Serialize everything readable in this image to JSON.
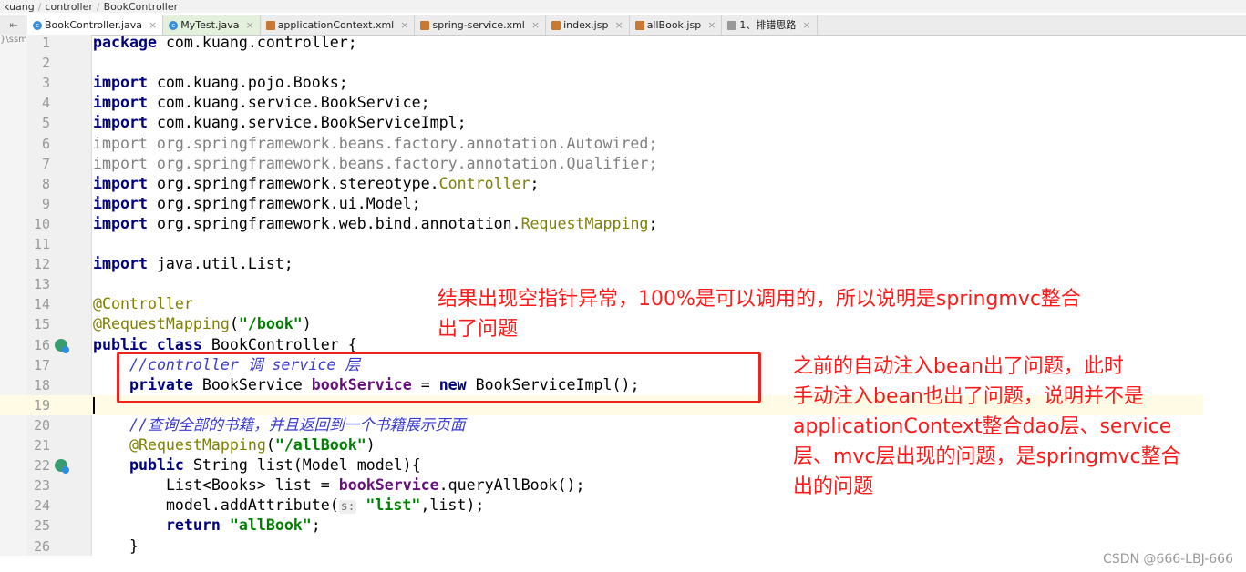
{
  "breadcrumb": [
    "kuang",
    "controller",
    "BookController"
  ],
  "tabs": [
    {
      "label": "BookController.java",
      "active": true
    },
    {
      "label": "MyTest.java"
    },
    {
      "label": "applicationContext.xml"
    },
    {
      "label": "spring-service.xml"
    },
    {
      "label": "index.jsp"
    },
    {
      "label": "allBook.jsp"
    },
    {
      "label": "1、排错思路"
    }
  ],
  "side_label": "}\\ssm",
  "code": [
    [
      [
        "package ",
        "kw"
      ],
      [
        "com.kuang.controller;",
        ""
      ]
    ],
    [],
    [
      [
        "import ",
        "kw"
      ],
      [
        "com.kuang.pojo.Books;",
        ""
      ]
    ],
    [
      [
        "import ",
        "kw"
      ],
      [
        "com.kuang.service.BookService;",
        ""
      ]
    ],
    [
      [
        "import ",
        "kw"
      ],
      [
        "com.kuang.service.BookServiceImpl;",
        ""
      ]
    ],
    [
      [
        "import org.springframework.beans.factory.annotation.Autowired;",
        "gray"
      ]
    ],
    [
      [
        "import org.springframework.beans.factory.annotation.Qualifier;",
        "gray"
      ]
    ],
    [
      [
        "import ",
        "kw"
      ],
      [
        "org.springframework.stereotype.",
        ""
      ],
      [
        "Controller",
        "ann"
      ],
      [
        ";",
        ""
      ]
    ],
    [
      [
        "import ",
        "kw"
      ],
      [
        "org.springframework.ui.Model;",
        ""
      ]
    ],
    [
      [
        "import ",
        "kw"
      ],
      [
        "org.springframework.web.bind.annotation.",
        ""
      ],
      [
        "RequestMapping",
        "ann"
      ],
      [
        ";",
        ""
      ]
    ],
    [],
    [
      [
        "import ",
        "kw"
      ],
      [
        "java.util.List;",
        ""
      ]
    ],
    [],
    [
      [
        "@Controller",
        "ann"
      ]
    ],
    [
      [
        "@RequestMapping",
        "ann"
      ],
      [
        "(",
        ""
      ],
      [
        "\"/book\"",
        "str"
      ],
      [
        ")",
        ""
      ]
    ],
    [
      [
        "public class ",
        "kw"
      ],
      [
        "BookController {",
        ""
      ]
    ],
    [
      [
        "    ",
        ""
      ],
      [
        "//controller 调 service 层",
        "cmt"
      ]
    ],
    [
      [
        "    ",
        ""
      ],
      [
        "private ",
        "kw"
      ],
      [
        "BookService ",
        ""
      ],
      [
        "bookService",
        "field"
      ],
      [
        " = ",
        ""
      ],
      [
        "new ",
        "kw"
      ],
      [
        "BookServiceImpl();",
        ""
      ]
    ],
    [],
    [
      [
        "    ",
        ""
      ],
      [
        "//查询全部的书籍，并且返回到一个书籍展示页面",
        "cmt"
      ]
    ],
    [
      [
        "    ",
        ""
      ],
      [
        "@RequestMapping",
        "ann"
      ],
      [
        "(",
        ""
      ],
      [
        "\"/allBook\"",
        "str"
      ],
      [
        ")",
        ""
      ]
    ],
    [
      [
        "    ",
        ""
      ],
      [
        "public ",
        "kw"
      ],
      [
        "String list(Model model){",
        ""
      ]
    ],
    [
      [
        "        ",
        ""
      ],
      [
        "List<Books> list = ",
        ""
      ],
      [
        "bookService",
        "field"
      ],
      [
        ".queryAllBook();",
        ""
      ]
    ],
    [
      [
        "        ",
        ""
      ],
      [
        "model.addAttribute(",
        ""
      ],
      [
        "s:",
        "hint"
      ],
      [
        " ",
        ""
      ],
      [
        "\"list\"",
        "str"
      ],
      [
        ",list);",
        ""
      ]
    ],
    [
      [
        "        ",
        ""
      ],
      [
        "return ",
        "kw"
      ],
      [
        "\"allBook\"",
        "str"
      ],
      [
        ";",
        ""
      ]
    ],
    [
      [
        "    }",
        ""
      ]
    ]
  ],
  "annotations": {
    "note1": [
      "结果出现空指针异常，100%是可以调用的，所以说明是springmvc整合",
      "出了问题"
    ],
    "note2": [
      "之前的自动注入bean出了问题，此时",
      "手动注入bean也出了问题，说明并不是",
      "applicationContext整合dao层、service",
      "层、mvc层出现的问题，是springmvc整合",
      "出的问题"
    ],
    "highlight_color": "#e8251f"
  },
  "watermark": "CSDN @666-LBJ-666"
}
